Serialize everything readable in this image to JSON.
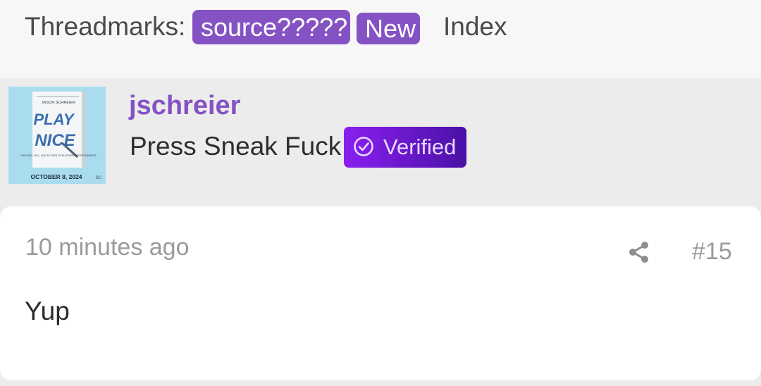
{
  "threadmarks": {
    "label": "Threadmarks:",
    "current_mark": "source?????",
    "new_badge": "New",
    "index_link": "Index"
  },
  "post": {
    "author": {
      "username": "jschreier",
      "user_title": "Press Sneak Fuck",
      "verified_label": "Verified",
      "avatar": {
        "book_author": "JASON SCHREIER",
        "book_title_line1": "PLAY",
        "book_title_line2": "NICE",
        "tagline": "THE RISE, FALL, AND FUTURE OF BLIZZARD ENTERTAINMENT",
        "release_date": "OCTOBER 8, 2024",
        "publisher_mark": "BC"
      }
    },
    "timestamp": "10 minutes ago",
    "number": "#15",
    "body": "Yup"
  },
  "icons": {
    "share": "share-icon",
    "verified": "check-circle-icon"
  },
  "colors": {
    "accent_purple": "#8552c4",
    "verified_gradient_start": "#8a1ff0",
    "verified_gradient_end": "#4a11a6",
    "muted_text": "#9a9a9a"
  }
}
